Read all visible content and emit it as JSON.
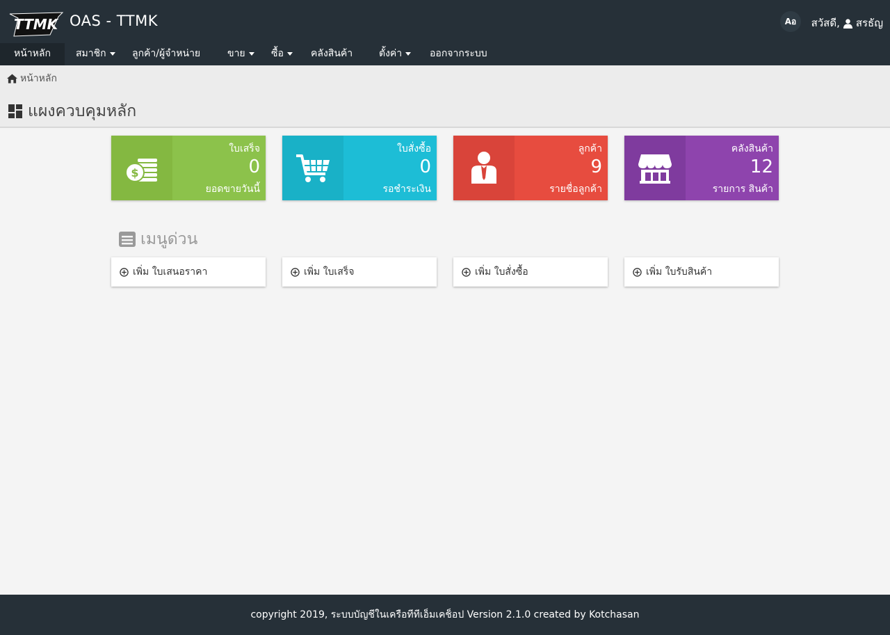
{
  "header": {
    "app_title": "OAS - TTMK",
    "logo_text": "TTMK",
    "lang_label": "Aอ",
    "greeting": "สวัสดี,",
    "user_name": "สรธัญ"
  },
  "nav": {
    "items": [
      {
        "label": "หน้าหลัก",
        "dropdown": false
      },
      {
        "label": "สมาชิก",
        "dropdown": true
      },
      {
        "label": "ลูกค้า/ผู้จำหน่าย",
        "dropdown": false
      },
      {
        "label": "ขาย",
        "dropdown": true
      },
      {
        "label": "ซื้อ",
        "dropdown": true
      },
      {
        "label": "คลังสินค้า",
        "dropdown": false
      },
      {
        "label": "ตั้งค่า",
        "dropdown": true
      },
      {
        "label": "ออกจากระบบ",
        "dropdown": false
      }
    ]
  },
  "breadcrumb": {
    "home": "หน้าหลัก"
  },
  "page": {
    "title": "แผงควบคุมหลัก"
  },
  "cards": [
    {
      "label": "ใบเสร็จ",
      "value": "0",
      "sub": "ยอดขายวันนี้",
      "icon": "coins-icon",
      "color_icon": "#84b841",
      "color_body": "#8cc24b"
    },
    {
      "label": "ใบสั่งซื้อ",
      "value": "0",
      "sub": "รอชำระเงิน",
      "icon": "cart-icon",
      "color_icon": "#19b1c7",
      "color_body": "#1dbdd6"
    },
    {
      "label": "ลูกค้า",
      "value": "9",
      "sub": "รายชื่อลูกค้า",
      "icon": "person-icon",
      "color_icon": "#d9443a",
      "color_body": "#e74c3f"
    },
    {
      "label": "คลังสินค้า",
      "value": "12",
      "sub": "รายการ สินค้า",
      "icon": "store-icon",
      "color_icon": "#7f3b9e",
      "color_body": "#8e44ad"
    }
  ],
  "quick_menu": {
    "title": "เมนูด่วน",
    "items": [
      {
        "label": "เพิ่ม ใบเสนอราคา"
      },
      {
        "label": "เพิ่ม ใบเสร็จ"
      },
      {
        "label": "เพิ่ม ใบสั่งซื้อ"
      },
      {
        "label": "เพิ่ม ใบรับสินค้า"
      }
    ]
  },
  "footer": {
    "text": "copyright 2019, ระบบบัญชีในเครือทีทีเอ็มเคช็อป Version 2.1.0 created by Kotchasan"
  }
}
